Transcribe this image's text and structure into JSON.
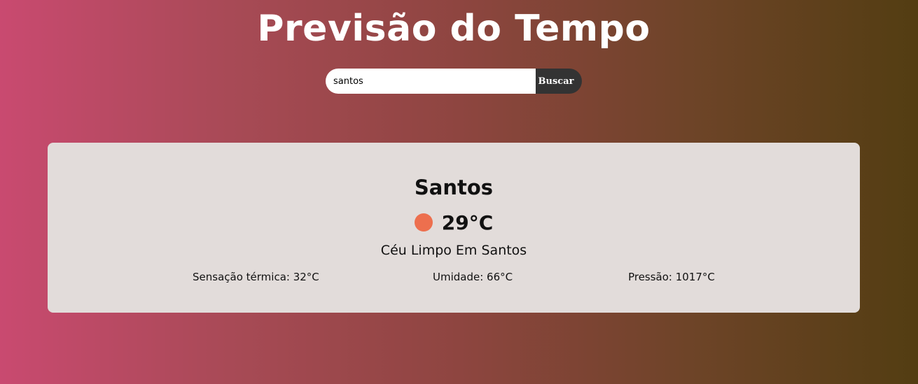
{
  "page": {
    "title": "Previsão do Tempo"
  },
  "search": {
    "value": "santos",
    "button_label": "Buscar"
  },
  "weather": {
    "city": "Santos",
    "icon": "sun-icon",
    "icon_color": "#ed6f4e",
    "temperature": "29°C",
    "description": "Céu Limpo Em Santos",
    "feels_like": "Sensação térmica: 32°C",
    "humidity": "Umidade: 66°C",
    "pressure": "Pressão: 1017°C"
  },
  "colors": {
    "gradient_start": "#c94a70",
    "gradient_end": "#533d12",
    "card_background": "#e2dcda",
    "button_background": "#333333"
  }
}
